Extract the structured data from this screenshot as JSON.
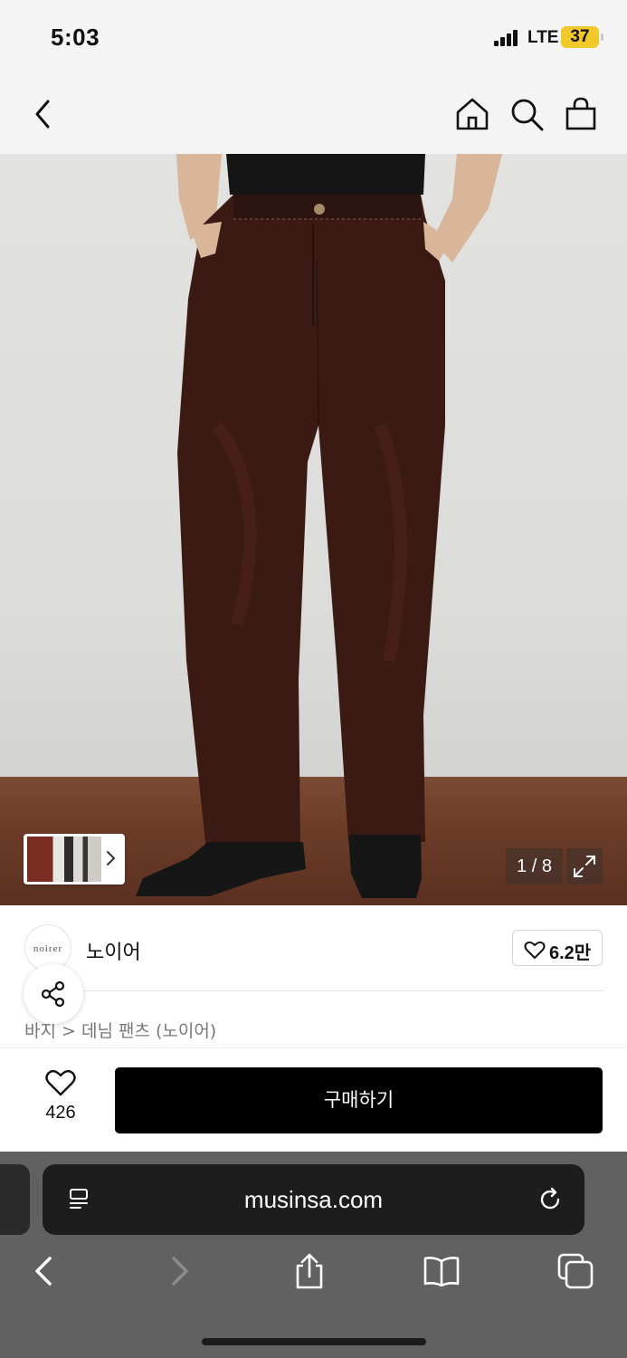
{
  "status_bar": {
    "time": "5:03",
    "network": "LTE",
    "battery": "37"
  },
  "header": {
    "back_icon": "chevron-left-icon",
    "home_icon": "home-icon",
    "search_icon": "search-icon",
    "cart_icon": "shopping-bag-icon"
  },
  "gallery": {
    "counter": "1 / 8",
    "expand_icon": "expand-icon",
    "thumb_arrow": "chevron-right-icon"
  },
  "product": {
    "brand_logo_text": "noirer",
    "brand_name": "노이어",
    "brand_likes": "6.2만",
    "breadcrumb": "바지 > 데님 팬츠 (노이어)"
  },
  "buy_bar": {
    "wish_count": "426",
    "buy_label": "구매하기"
  },
  "browser": {
    "url": "musinsa.com"
  },
  "colors": {
    "accent": "#000000",
    "battery": "#f2c92b",
    "pants": "#3b1a14",
    "floor": "#6b3b27"
  }
}
